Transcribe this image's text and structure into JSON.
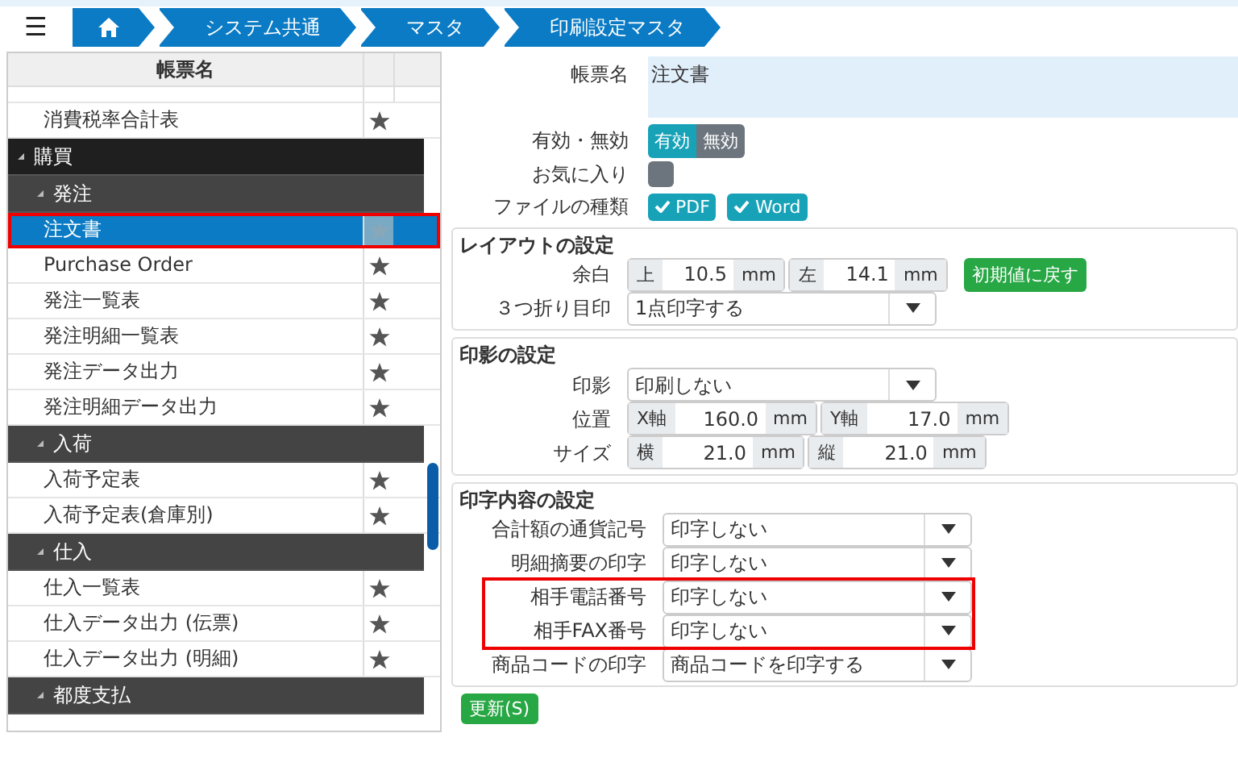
{
  "menu_button": "☰",
  "breadcrumb": [
    "システム共通",
    "マスタ",
    "印刷設定マスタ"
  ],
  "list": {
    "header": "帳票名",
    "items": [
      {
        "kind": "item",
        "label": "消費税率合計表",
        "selected": false,
        "highlighted": false
      },
      {
        "kind": "group",
        "label": "購買",
        "expanded": true,
        "children": [
          {
            "kind": "group",
            "label": "発注",
            "expanded": true,
            "children": [
              {
                "kind": "item",
                "label": "注文書",
                "selected": true,
                "highlighted": true
              },
              {
                "kind": "item",
                "label": "Purchase Order",
                "selected": false,
                "highlighted": false
              },
              {
                "kind": "item",
                "label": "発注一覧表",
                "selected": false,
                "highlighted": false
              },
              {
                "kind": "item",
                "label": "発注明細一覧表",
                "selected": false,
                "highlighted": false
              },
              {
                "kind": "item",
                "label": "発注データ出力",
                "selected": false,
                "highlighted": false
              },
              {
                "kind": "item",
                "label": "発注明細データ出力",
                "selected": false,
                "highlighted": false
              }
            ]
          },
          {
            "kind": "group",
            "label": "入荷",
            "expanded": true,
            "children": [
              {
                "kind": "item",
                "label": "入荷予定表",
                "selected": false,
                "highlighted": false
              },
              {
                "kind": "item",
                "label": "入荷予定表(倉庫別)",
                "selected": false,
                "highlighted": false
              }
            ]
          },
          {
            "kind": "group",
            "label": "仕入",
            "expanded": true,
            "children": [
              {
                "kind": "item",
                "label": "仕入一覧表",
                "selected": false,
                "highlighted": false
              },
              {
                "kind": "item",
                "label": "仕入データ出力 (伝票)",
                "selected": false,
                "highlighted": false
              },
              {
                "kind": "item",
                "label": "仕入データ出力 (明細)",
                "selected": false,
                "highlighted": false
              }
            ]
          },
          {
            "kind": "group",
            "label": "都度支払",
            "expanded": true
          }
        ]
      }
    ]
  },
  "form": {
    "name_label": "帳票名",
    "name_value": "注文書",
    "status_label": "有効・無効",
    "status_options": [
      {
        "label": "有効",
        "selected": true
      },
      {
        "label": "無効",
        "selected": false
      }
    ],
    "favorite_label": "お気に入り",
    "favorite_checked": false,
    "filetype_label": "ファイルの種類",
    "filetypes": [
      {
        "label": "PDF",
        "checked": true
      },
      {
        "label": "Word",
        "checked": true
      }
    ]
  },
  "layout": {
    "title": "レイアウトの設定",
    "margin_label": "余白",
    "margins": [
      {
        "prefix": "上",
        "value": "10.5",
        "unit": "mm"
      },
      {
        "prefix": "左",
        "value": "14.1",
        "unit": "mm"
      }
    ],
    "reset_button": "初期値に戻す",
    "fold_label": "３つ折り目印",
    "fold_value": "1点印字する"
  },
  "stamp": {
    "title": "印影の設定",
    "stamp_label": "印影",
    "stamp_value": "印刷しない",
    "rows": [
      {
        "label": "位置",
        "fields": [
          {
            "prefix": "X軸",
            "value": "160.0",
            "unit": "mm"
          },
          {
            "prefix": "Y軸",
            "value": "17.0",
            "unit": "mm"
          }
        ]
      },
      {
        "label": "サイズ",
        "fields": [
          {
            "prefix": "横",
            "value": "21.0",
            "unit": "mm"
          },
          {
            "prefix": "縦",
            "value": "21.0",
            "unit": "mm"
          }
        ]
      }
    ]
  },
  "print": {
    "title": "印字内容の設定",
    "groups": [
      {
        "highlighted": false,
        "rows": [
          {
            "label": "合計額の通貨記号",
            "value": "印字しない"
          },
          {
            "label": "明細摘要の印字",
            "value": "印字しない"
          }
        ]
      },
      {
        "highlighted": true,
        "rows": [
          {
            "label": "相手電話番号",
            "value": "印字しない"
          },
          {
            "label": "相手FAX番号",
            "value": "印字しない"
          }
        ]
      },
      {
        "highlighted": false,
        "rows": [
          {
            "label": "商品コードの印字",
            "value": "商品コードを印字する"
          }
        ]
      }
    ]
  },
  "update_button": "更新(S)"
}
